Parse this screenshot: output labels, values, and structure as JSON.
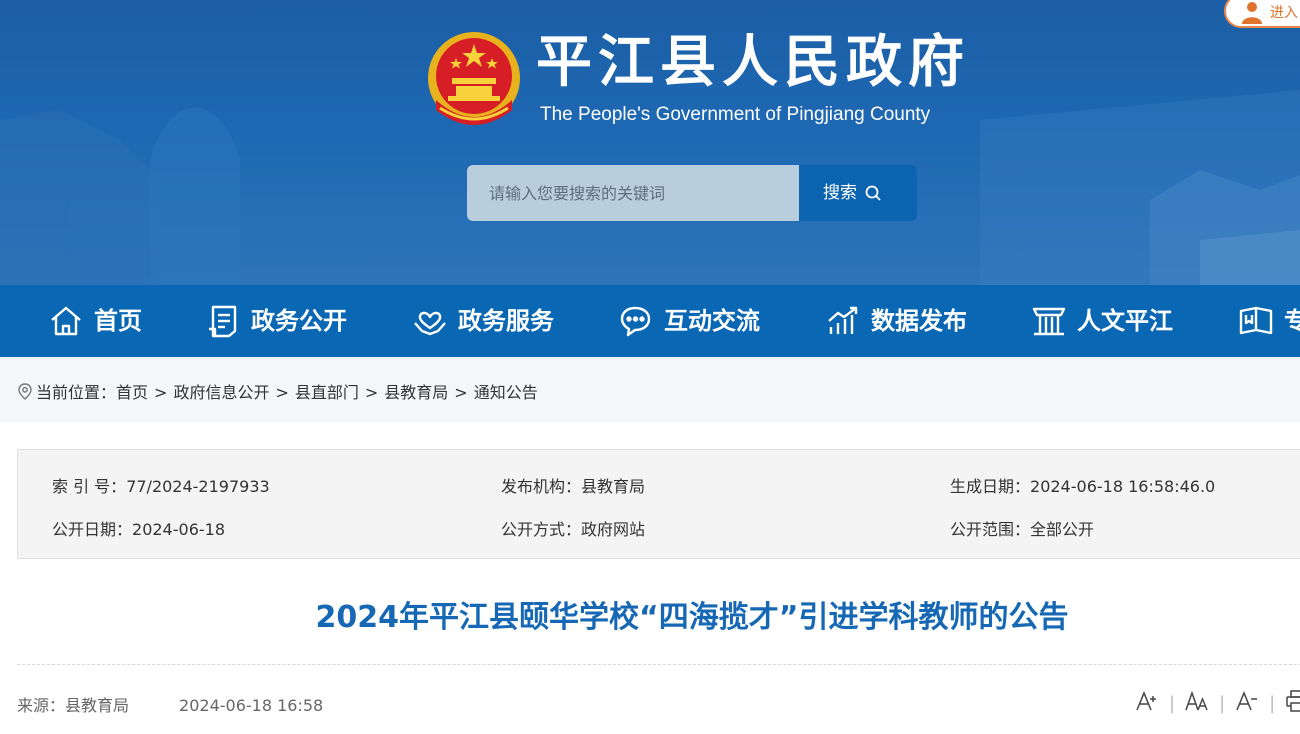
{
  "header": {
    "title": "平江县人民政府",
    "subtitle": "The People's Government of Pingjiang County",
    "login_label": "进入"
  },
  "search": {
    "placeholder": "请输入您要搜索的关键词",
    "button_label": "搜索"
  },
  "nav": {
    "items": [
      {
        "label": "首页",
        "icon": "home-icon"
      },
      {
        "label": "政务公开",
        "icon": "document-icon"
      },
      {
        "label": "政务服务",
        "icon": "heart-hand-icon"
      },
      {
        "label": "互动交流",
        "icon": "chat-icon"
      },
      {
        "label": "数据发布",
        "icon": "chart-icon"
      },
      {
        "label": "人文平江",
        "icon": "landmark-icon"
      },
      {
        "label": "专",
        "icon": "book-icon"
      }
    ]
  },
  "breadcrumb": {
    "prefix": "当前位置：",
    "items": [
      "首页",
      "政府信息公开",
      "县直部门",
      "县教育局",
      "通知公告"
    ],
    "separator": ">"
  },
  "meta": {
    "index_label": "索 引 号：",
    "index_value": "77/2024-2197933",
    "org_label": "发布机构：",
    "org_value": "县教育局",
    "created_label": "生成日期：",
    "created_value": "2024-06-18 16:58:46.0",
    "public_date_label": "公开日期：",
    "public_date_value": "2024-06-18",
    "method_label": "公开方式：",
    "method_value": "政府网站",
    "scope_label": "公开范围：",
    "scope_value": "全部公开"
  },
  "article": {
    "title": "2024年平江县颐华学校“四海揽才”引进学科教师的公告",
    "source_label": "来源：",
    "source_value": "县教育局",
    "datetime": "2024-06-18 16:58"
  },
  "colors": {
    "header_blue": "#1e68b3",
    "nav_blue": "#0a67b3",
    "title_blue": "#1768b4",
    "login_orange": "#e0742c"
  }
}
